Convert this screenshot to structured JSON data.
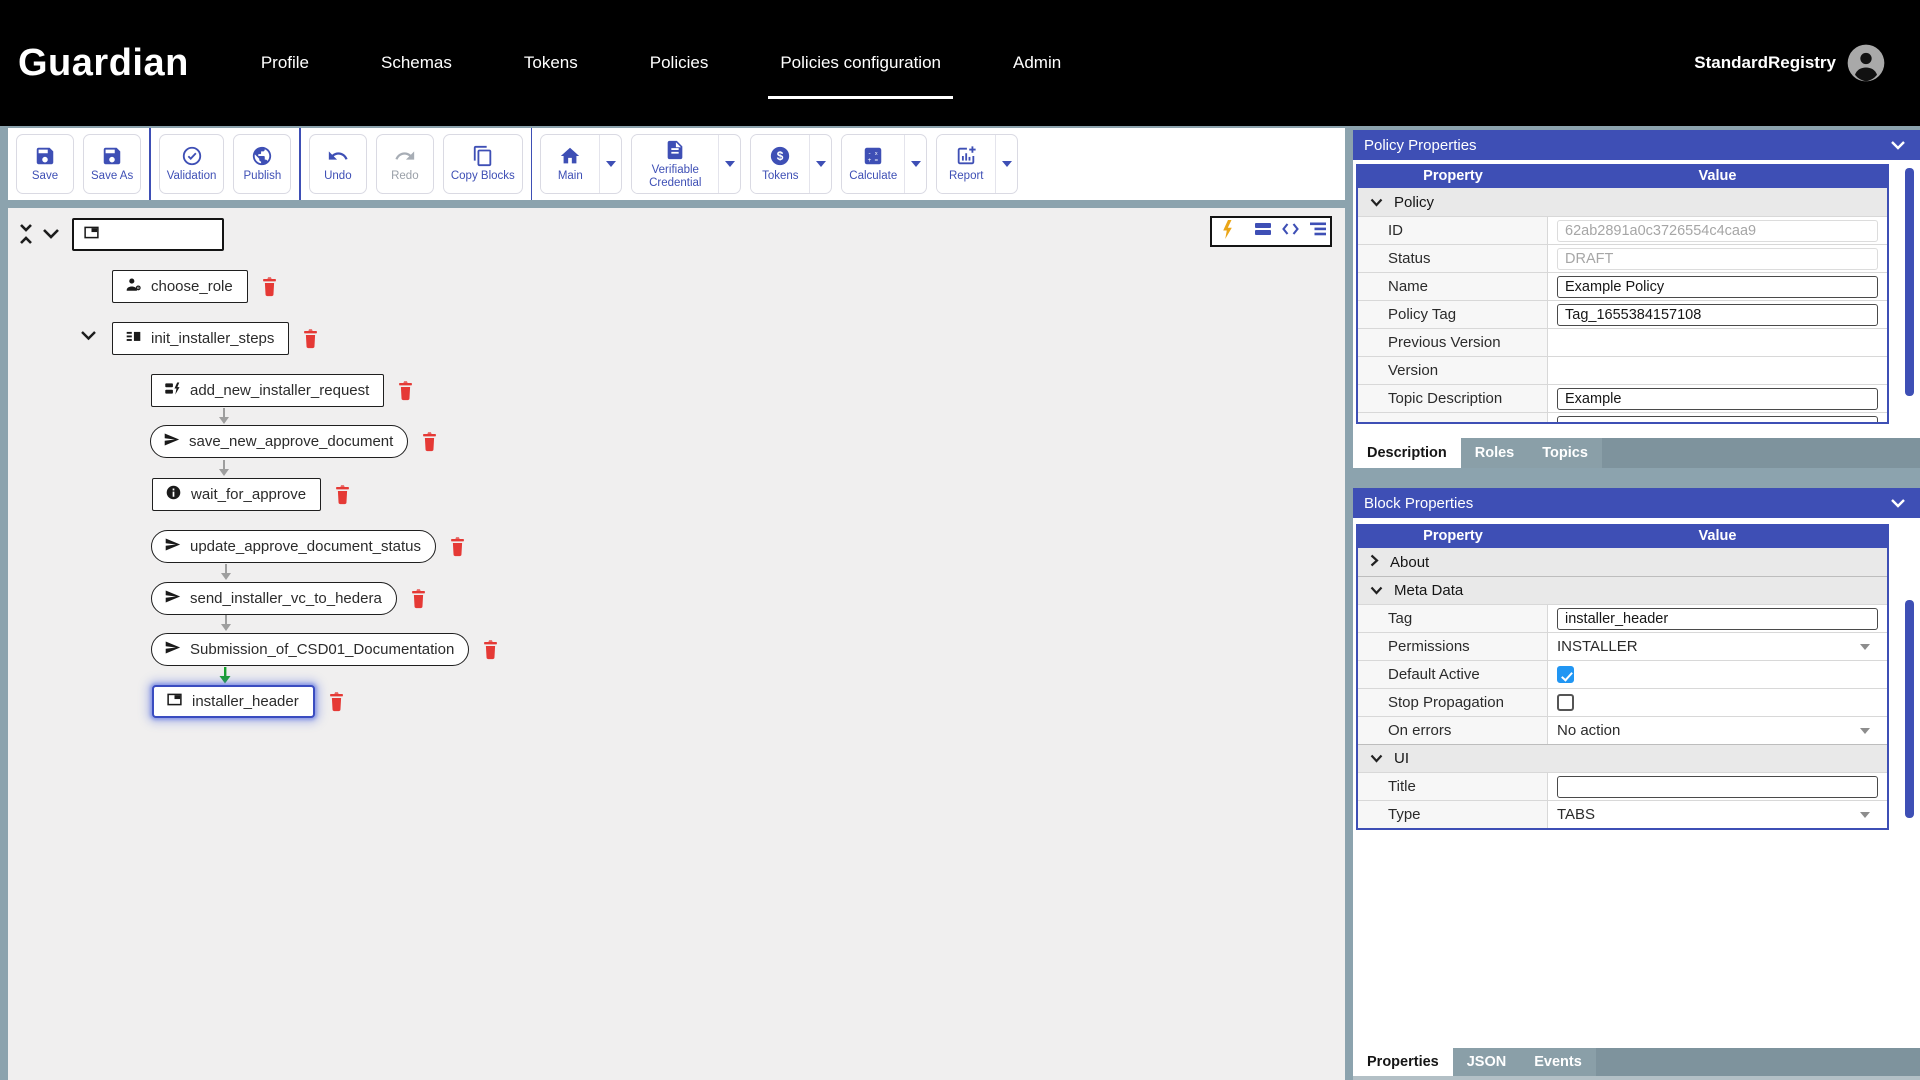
{
  "colors": {
    "accent": "#3e4fb5",
    "nav_bg": "#000000",
    "page_bg": "#8ca3ae",
    "canvas_bg": "#f0efef",
    "danger": "#e53935",
    "checkbox_checked": "#2196f3",
    "connector": "#9e9e9e",
    "connector_active": "#17a02e",
    "lightning": "#eaa517"
  },
  "nav": {
    "brand": "Guardian",
    "items": [
      {
        "label": "Profile",
        "active": false
      },
      {
        "label": "Schemas",
        "active": false
      },
      {
        "label": "Tokens",
        "active": false
      },
      {
        "label": "Policies",
        "active": false
      },
      {
        "label": "Policies configuration",
        "active": true
      },
      {
        "label": "Admin",
        "active": false
      }
    ],
    "user": {
      "name": "StandardRegistry",
      "icon": "user-avatar-icon"
    }
  },
  "toolbar": {
    "buttons": [
      {
        "label": "Save",
        "icon": "save-icon"
      },
      {
        "label": "Save As",
        "icon": "save-as-icon"
      },
      {
        "label": "Validation",
        "icon": "check-circle-icon"
      },
      {
        "label": "Publish",
        "icon": "globe-icon"
      },
      {
        "label": "Undo",
        "icon": "undo-icon"
      },
      {
        "label": "Redo",
        "icon": "redo-icon",
        "disabled": true
      },
      {
        "label": "Copy Blocks",
        "icon": "copy-icon"
      },
      {
        "label": "Main",
        "icon": "home-icon",
        "dropdown": true
      },
      {
        "label": "Verifiable Credential",
        "icon": "document-icon",
        "dropdown": true
      },
      {
        "label": "Tokens",
        "icon": "dollar-circle-icon",
        "dropdown": true
      },
      {
        "label": "Calculate",
        "icon": "calculator-icon",
        "dropdown": true
      },
      {
        "label": "Report",
        "icon": "chart-add-icon",
        "dropdown": true
      }
    ]
  },
  "canvas": {
    "root_block_label": "",
    "view_controls": [
      "lightning-icon",
      "stacked-bars-icon",
      "code-icon",
      "tree-lines-icon"
    ]
  },
  "tree": {
    "blocks": [
      {
        "label": "choose_role",
        "icon": "user-role-icon",
        "shape": "rect",
        "connector": "none"
      },
      {
        "label": "init_installer_steps",
        "icon": "vertical-split-icon",
        "shape": "rect",
        "expanded": true,
        "connector": "none"
      },
      {
        "label": "add_new_installer_request",
        "icon": "request-form-icon",
        "shape": "rect",
        "connector": "none"
      },
      {
        "label": "save_new_approve_document",
        "icon": "send-icon",
        "shape": "pill",
        "connector": "gray"
      },
      {
        "label": "wait_for_approve",
        "icon": "info-icon",
        "shape": "rect",
        "connector": "gray"
      },
      {
        "label": "update_approve_document_status",
        "icon": "send-icon",
        "shape": "pill",
        "connector": "none"
      },
      {
        "label": "send_installer_vc_to_hedera",
        "icon": "send-icon",
        "shape": "pill",
        "connector": "gray"
      },
      {
        "label": "Submission_of_CSD01_Documentation",
        "icon": "send-icon",
        "shape": "pill",
        "connector": "gray"
      },
      {
        "label": "installer_header",
        "icon": "tab-icon",
        "shape": "rect",
        "connector": "green",
        "selected": true
      }
    ]
  },
  "policy_properties": {
    "title": "Policy Properties",
    "columns": {
      "property": "Property",
      "value": "Value"
    },
    "group": "Policy",
    "rows": [
      {
        "label": "ID",
        "value": "62ab2891a0c3726554c4caa9",
        "kind": "readonly"
      },
      {
        "label": "Status",
        "value": "DRAFT",
        "kind": "readonly"
      },
      {
        "label": "Name",
        "value": "Example Policy",
        "kind": "input"
      },
      {
        "label": "Policy Tag",
        "value": "Tag_1655384157108",
        "kind": "input"
      },
      {
        "label": "Previous Version",
        "value": "",
        "kind": "empty"
      },
      {
        "label": "Version",
        "value": "",
        "kind": "empty"
      },
      {
        "label": "Topic Description",
        "value": "Example",
        "kind": "input"
      }
    ],
    "tabs": {
      "items": [
        "Description",
        "Roles",
        "Topics"
      ],
      "active": "Description"
    }
  },
  "block_properties": {
    "title": "Block Properties",
    "columns": {
      "property": "Property",
      "value": "Value"
    },
    "groups": [
      {
        "label": "About",
        "expanded": false
      },
      {
        "label": "Meta Data",
        "expanded": true
      },
      {
        "label": "UI",
        "expanded": true
      }
    ],
    "meta_rows": [
      {
        "label": "Tag",
        "value": "installer_header",
        "kind": "input"
      },
      {
        "label": "Permissions",
        "value": "INSTALLER",
        "kind": "select"
      },
      {
        "label": "Default Active",
        "checked": true,
        "kind": "checkbox"
      },
      {
        "label": "Stop Propagation",
        "checked": false,
        "kind": "checkbox"
      },
      {
        "label": "On errors",
        "value": "No action",
        "kind": "select"
      }
    ],
    "ui_rows": [
      {
        "label": "Title",
        "value": "",
        "kind": "input"
      },
      {
        "label": "Type",
        "value": "TABS",
        "kind": "select"
      }
    ],
    "tabs": {
      "items": [
        "Properties",
        "JSON",
        "Events"
      ],
      "active": "Properties"
    }
  }
}
